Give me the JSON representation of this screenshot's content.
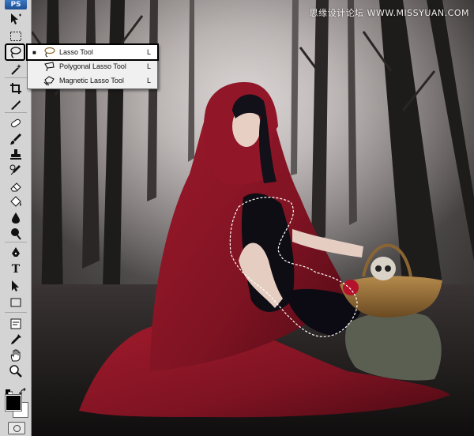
{
  "app": {
    "logo_text": "PS"
  },
  "watermark": {
    "text": "思缘设计论坛 WWW.MISSYUAN.COM"
  },
  "flyout": {
    "items": [
      {
        "label": "Lasso Tool",
        "shortcut": "L",
        "selected": true,
        "icon": "lasso-icon"
      },
      {
        "label": "Polygonal Lasso Tool",
        "shortcut": "L",
        "selected": false,
        "icon": "polygonal-lasso-icon"
      },
      {
        "label": "Magnetic Lasso Tool",
        "shortcut": "L",
        "selected": false,
        "icon": "magnetic-lasso-icon"
      }
    ],
    "bullet": "■"
  },
  "toolbar": {
    "tools": [
      "move-tool-icon",
      "marquee-tool-icon",
      "lasso-tool-icon",
      "magic-wand-icon",
      "crop-tool-icon",
      "eyedropper-icon",
      "healing-brush-icon",
      "brush-tool-icon",
      "clone-stamp-icon",
      "history-brush-icon",
      "eraser-icon",
      "paint-bucket-icon",
      "blur-tool-icon",
      "dodge-tool-icon",
      "pen-tool-icon",
      "type-tool-icon",
      "path-selection-icon",
      "rectangle-tool-icon",
      "notes-tool-icon",
      "eyedropper-icon",
      "hand-tool-icon",
      "zoom-tool-icon"
    ],
    "type_tool_glyph": "T",
    "colors": {
      "foreground": "#000000",
      "background": "#ffffff"
    }
  },
  "colors": {
    "toolbar_bg": "#d4d4d4",
    "flyout_bg": "#f0f0f0",
    "cloak": "#8e1525"
  }
}
